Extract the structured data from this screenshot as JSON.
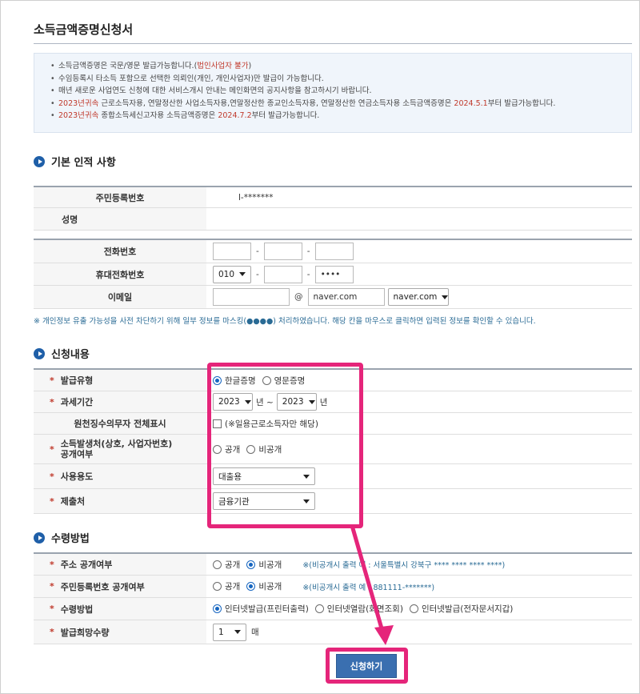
{
  "page": {
    "title": "소득금액증명신청서"
  },
  "notice": {
    "line1_pre": "소득금액증명은 국문/영문 발급가능합니다.(",
    "line1_red": "법인사업자 불가",
    "line1_post": ")",
    "line2": "수임등록시 타소득 포함으로 선택한 의뢰인(개인, 개인사업자)만 발급이 가능합니다.",
    "line3": "매년 새로운 사업연도 신청에 대한 서비스개시 안내는 메인화면의 공지사항을 참고하시기 바랍니다.",
    "line4_red": "2023년귀속",
    "line4_mid": " 근로소득자용, 연말정산한 사업소득자용,연말정산한 종교인소득자용, 연말정산한 연금소득자용 소득금액증명은 ",
    "line4_red2": "2024.5.1",
    "line4_post": "부터 발급가능합니다.",
    "line5_red": "2023년귀속",
    "line5_mid": " 종합소득세신고자용 소득금액증명은 ",
    "line5_red2": "2024.7.2",
    "line5_post": "부터 발급가능합니다."
  },
  "basic": {
    "heading": "기본 인적 사항",
    "rrn_label": "주민등록번호",
    "rrn_value": "l-*******",
    "name_label": "성명",
    "name_value": "",
    "phone_label": "전화번호",
    "mobile_label": "휴대전화번호",
    "mobile_prefix": "010",
    "mobile_last": "••••",
    "email_label": "이메일",
    "email_at": "@",
    "email_domain": "naver.com",
    "email_domain_select": "naver.com",
    "mask_note": "※ 개인정보 유출 가능성을 사전 차단하기 위해 일부 정보를 마스킹(●●●●) 처리하였습니다. 해당 칸을 마우스로 클릭하면 입력된 정보를 확인할 수 있습니다."
  },
  "apply": {
    "heading": "신청내용",
    "star": "*",
    "type_label": "발급유형",
    "type_korean": "한글증명",
    "type_english": "영문증명",
    "period_label": "과세기간",
    "period_from": "2023",
    "period_from_unit": "년 ~",
    "period_to": "2023",
    "period_to_unit": "년",
    "withholder_label": "원천징수의무자 전체표시",
    "withholder_option": "(※일용근로소득자만 해당)",
    "source_label_1": "소득발생처(상호, 사업자번호)",
    "source_label_2": "공개여부",
    "open": "공개",
    "closed": "비공개",
    "purpose_label": "사용용도",
    "purpose_value": "대출용",
    "submit_to_label": "제출처",
    "submit_to_value": "금융기관"
  },
  "receive": {
    "heading": "수령방법",
    "address_label": "주소 공개여부",
    "address_example": "※(비공개시 출력 예 : 서울특별시 강북구 **** **** **** ****)",
    "rrn_open_label": "주민등록번호 공개여부",
    "rrn_example": "※(비공개시 출력 예 : 881111-*******)",
    "method_label": "수령방법",
    "method_print": "인터넷발급(프린터출력)",
    "method_view": "인터넷열람(화면조회)",
    "method_doc": "인터넷발급(전자문서지갑)",
    "quantity_label": "발급희망수량",
    "quantity_value": "1",
    "quantity_unit": "매"
  },
  "submit_label": "신청하기",
  "colors": {
    "accent": "#1f5fa8",
    "required": "#c0392b",
    "highlight": "#e5257a",
    "button": "#3a6fb0"
  }
}
